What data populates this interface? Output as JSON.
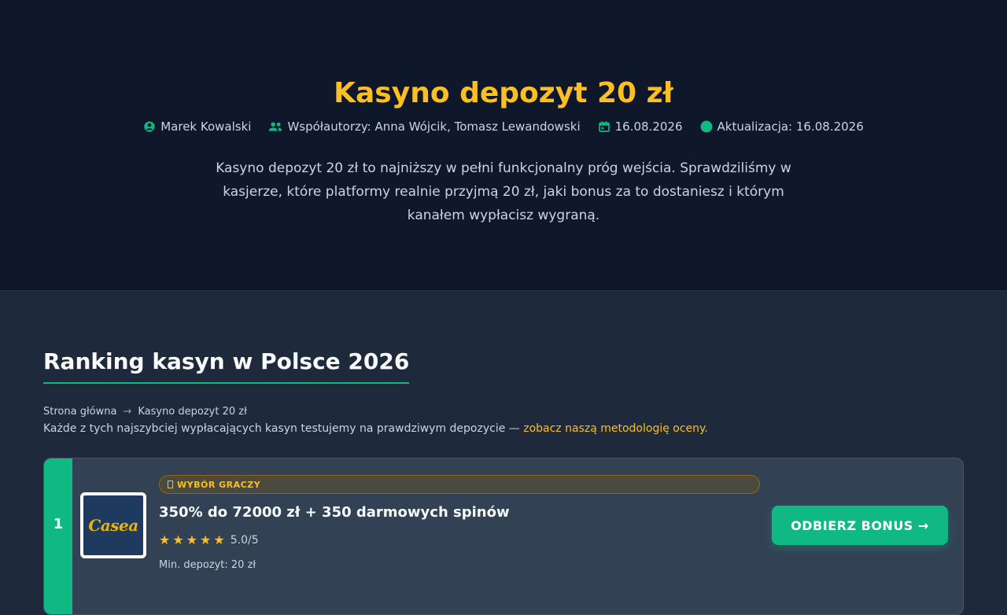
{
  "hero": {
    "title": "Kasyno depozyt 20 zł",
    "author": "Marek Kowalski",
    "coauthors": "Współautorzy: Anna Wójcik, Tomasz Lewandowski",
    "date": "16.08.2026",
    "updated": "Aktualizacja: 16.08.2026",
    "intro": "Kasyno depozyt 20 zł to najniższy w pełni funkcjonalny próg wejścia. Sprawdziliśmy w kasjerze, które platformy realnie przyjmą 20 zł, jaki bonus za to dostaniesz i którym kanałem wypłacisz wygraną."
  },
  "ranking": {
    "title": "Ranking kasyn w Polsce 2026",
    "breadcrumb": [
      "Strona główna",
      "Kasyno depozyt 20 zł"
    ],
    "breadcrumb_sep": "→",
    "notice": "Każde z tych najszybciej wypłacających kasyn testujemy na prawdziwym depozycie —",
    "notice_link": "zobacz naszą metodologię oceny."
  },
  "casinos": [
    {
      "rank": "1",
      "logo_text": "Casea",
      "badge": "WYBÓR GRACZY",
      "bonus": "350% do 72000 zł + 350 darmowych spinów",
      "stars": "★★★★★",
      "score": "5.0/5",
      "min_deposit": "Min. depozyt: 20 zł",
      "cta": "ODBIERZ BONUS →"
    }
  ],
  "colors": {
    "accent": "#fbbf24",
    "brand": "#10b981",
    "hero_bg": "#0f172a",
    "page_bg": "#1e293b"
  }
}
